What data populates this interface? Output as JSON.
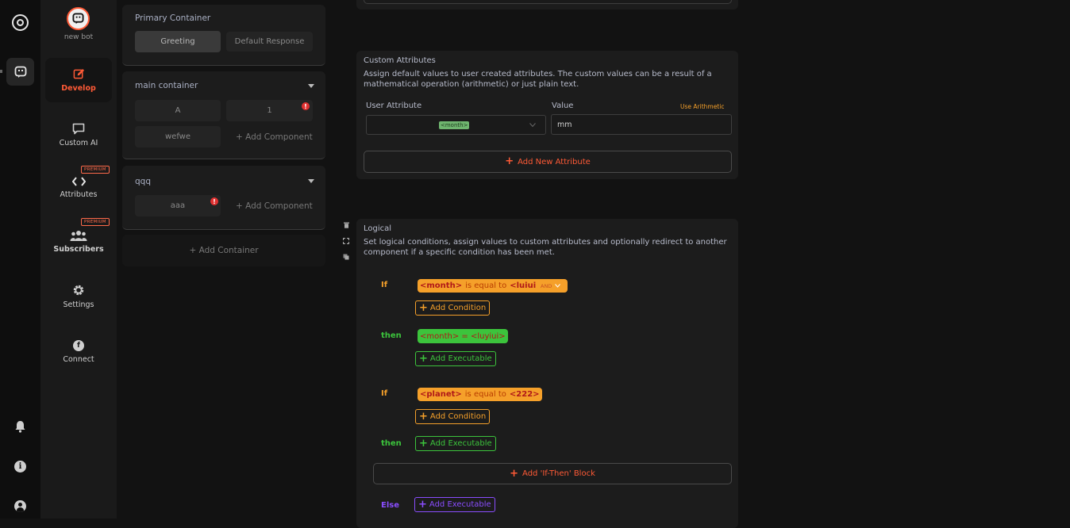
{
  "bot": {
    "name": "new bot"
  },
  "nav": {
    "items": [
      {
        "label": "Develop",
        "icon": "edit-icon",
        "active": true
      },
      {
        "label": "Custom AI",
        "icon": "chat-icon"
      },
      {
        "label": "Attributes",
        "icon": "code-icon",
        "badge": "PREMIUM"
      },
      {
        "label": "Subscribers",
        "icon": "users-icon",
        "badge": "PREMIUM"
      },
      {
        "label": "Settings",
        "icon": "gear-icon"
      },
      {
        "label": "Connect",
        "icon": "facebook-icon"
      }
    ]
  },
  "containers": {
    "primary": {
      "title": "Primary Container",
      "items": [
        "Greeting",
        "Default Response"
      ]
    },
    "main": {
      "title": "main container",
      "items": [
        "A",
        "1",
        "wefwe"
      ],
      "add_label": "+ Add Component"
    },
    "qqq": {
      "title": "qqq",
      "items": [
        "aaa"
      ],
      "add_label": "+ Add Component"
    },
    "add_container_label": "+ Add Container"
  },
  "custom_attributes": {
    "title": "Custom Attributes",
    "description": "Assign default values to user created attributes. The custom values can be a result of a mathematical operation (arithmetic) or just plain text.",
    "user_attribute_label": "User Attribute",
    "value_label": "Value",
    "use_arithmetic_label": "Use Arithmetic",
    "selected_attribute": "<month>",
    "value": "mm",
    "add_button": "Add New Attribute"
  },
  "logical": {
    "title": "Logical",
    "description": "Set logical conditions, assign values to custom attributes and optionally redirect to another component if a specific condition has been met.",
    "if_label": "If",
    "then_label": "then",
    "else_label": "Else",
    "block1": {
      "condition": {
        "attr": "<month>",
        "op": "is equal to",
        "value": "<luiui>"
      },
      "joiner": "AND",
      "add_condition": "Add Condition",
      "executable": "<month> = <luyiui>",
      "add_executable": "Add Executable"
    },
    "block2": {
      "condition": {
        "attr": "<planet>",
        "op": "is equal to",
        "value": "<222>"
      },
      "add_condition": "Add Condition",
      "add_executable": "Add Executable"
    },
    "add_block": "Add 'If-Then' Block",
    "else_add_executable": "Add Executable"
  },
  "colors": {
    "accent": "#ff5a36",
    "orange": "#f5a02a",
    "green": "#3cc43c",
    "purple": "#8a4dff"
  }
}
